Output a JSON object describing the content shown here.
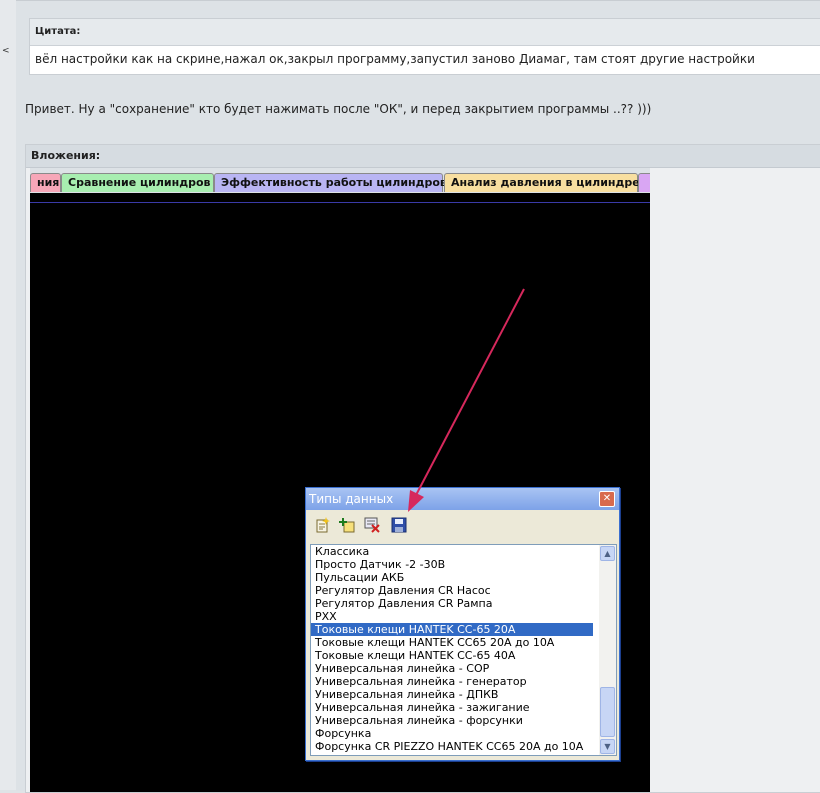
{
  "quote": {
    "header": "Цитата:",
    "text": "вёл настройки как на скрине,нажал ок,закрыл программу,запустил заново Диамаг, там стоят другие настройки"
  },
  "reply_text": "Привет. Ну а \"сохранение\" кто будет нажимать после \"ОК\", и перед закрытием программы ..?? )))",
  "attachments": {
    "header": "Вложения:"
  },
  "tabs": [
    {
      "label": "ния",
      "color": "#f7a7b8"
    },
    {
      "label": "Сравнение цилиндров",
      "color": "#a8eeb0"
    },
    {
      "label": "Эффективность работы цилиндров",
      "color": "#b9b5f3"
    },
    {
      "label": "Анализ давления в цилиндре",
      "color": "#f8dfa0"
    },
    {
      "label": "",
      "color": "#d9a6f3"
    }
  ],
  "dialog": {
    "title": "Типы данных",
    "close_glyph": "✕",
    "toolbar": [
      {
        "icon": "new-item-icon"
      },
      {
        "icon": "add-item-icon"
      },
      {
        "icon": "delete-item-icon"
      },
      {
        "icon": "save-icon"
      }
    ],
    "items": [
      "Классика",
      "Просто Датчик -2 -30В",
      "Пульсации АКБ",
      "Регулятор Давления CR Насос",
      "Регулятор Давления CR Рампа",
      "РХХ",
      "Токовые клещи HANTEK CC-65 20A",
      "Токовые клещи HANTEK CC65 20A до 10A",
      "Токовые клещи HANTEK CC-65 40A",
      "Универсальная линейка - СОР",
      "Универсальная линейка - генератор",
      "Универсальная линейка - ДПКВ",
      "Универсальная линейка - зажигание",
      "Универсальная линейка - форсунки",
      "Форсунка",
      "Форсунка CR PIEZZO HANTEK CC65 20A до 10A"
    ],
    "selected_index": 6
  },
  "colors": {
    "arrow": "#d6285c",
    "selection": "#316ac5"
  }
}
